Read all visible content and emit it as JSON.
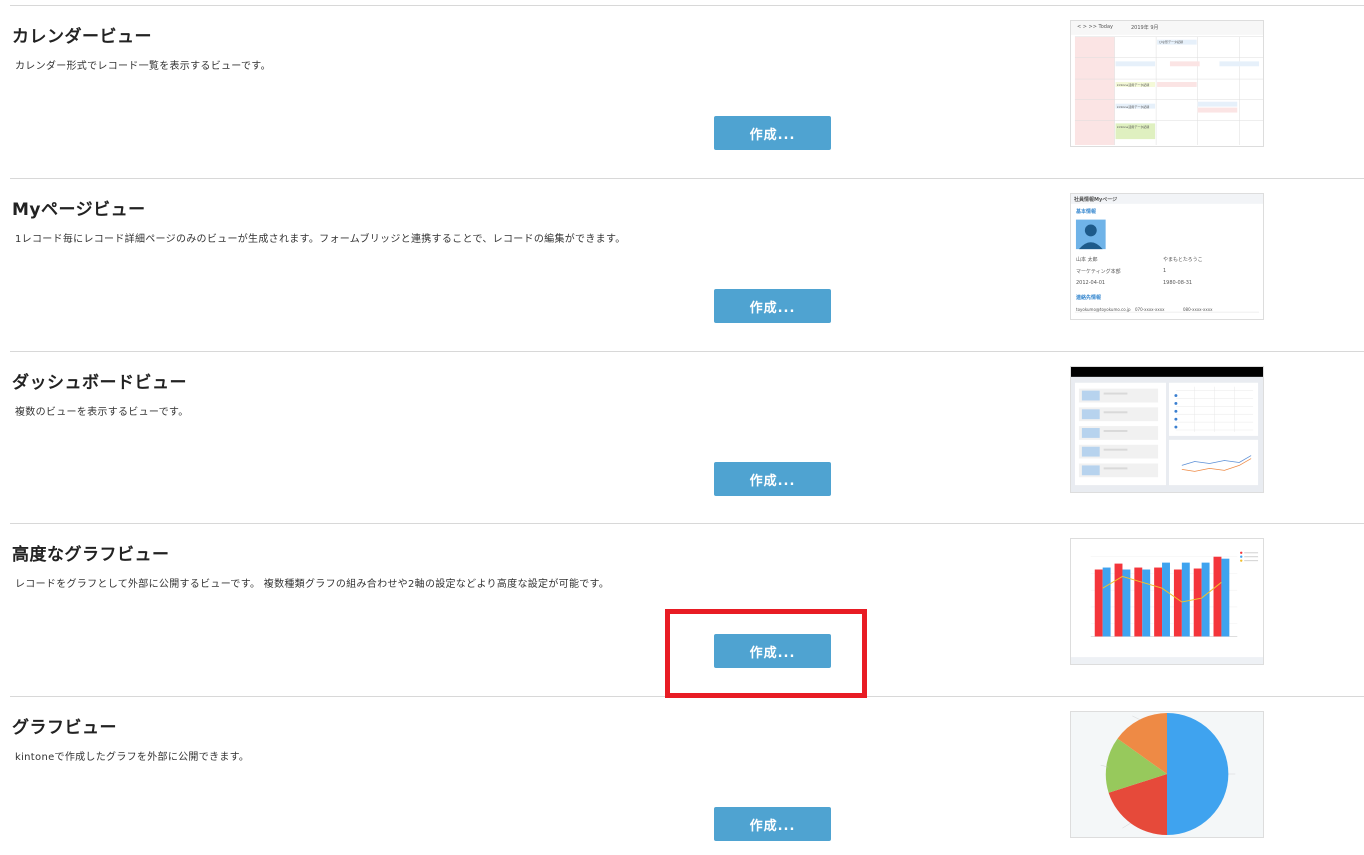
{
  "views": [
    {
      "id": "calendar",
      "title": "カレンダービュー",
      "description": "カレンダー形式でレコード一覧を表示するビューです。",
      "button_label": "作成...",
      "thumb": {
        "month_label": "2019年 9月",
        "nav_label": "< > >> Today",
        "events": [
          "ひな形データ記録",
          "kintone活用データ記録",
          "kintone活用データ記録",
          "kintone活用データ記録"
        ]
      }
    },
    {
      "id": "mypage",
      "title": "Myページビュー",
      "description": "1レコード毎にレコード詳細ページのみのビューが生成されます。フォームブリッジと連携することで、レコードの編集ができます。",
      "button_label": "作成...",
      "thumb": {
        "page_title": "社員情報Myページ",
        "section1": "基本情報",
        "name": "山本 太郎",
        "kana": "やまもとたろうこ",
        "dept": "マーケティング本部",
        "num": "1",
        "date1": "2012-04-01",
        "date2": "1980-08-31",
        "section2": "連絡先情報",
        "email": "toyokumo@toyokumo.co.jp",
        "tel1": "070-xxxx-xxxx",
        "tel2": "080-xxxx-xxxx"
      }
    },
    {
      "id": "dashboard",
      "title": "ダッシュボードビュー",
      "description": "複数のビューを表示するビューです。",
      "button_label": "作成..."
    },
    {
      "id": "advanced-graph",
      "title": "高度なグラフビュー",
      "description": "レコードをグラフとして外部に公開するビューです。 複数種類グラフの組み合わせや2軸の設定などより高度な設定が可能です。",
      "button_label": "作成..."
    },
    {
      "id": "graph",
      "title": "グラフビュー",
      "description": "kintoneで作成したグラフを外部に公開できます。",
      "button_label": "作成..."
    }
  ],
  "colors": {
    "button": "#4fa3d1",
    "highlight": "#e81c24",
    "pie": [
      "#3fa3ef",
      "#e64a3a",
      "#97c95c",
      "#ee8a45"
    ]
  }
}
